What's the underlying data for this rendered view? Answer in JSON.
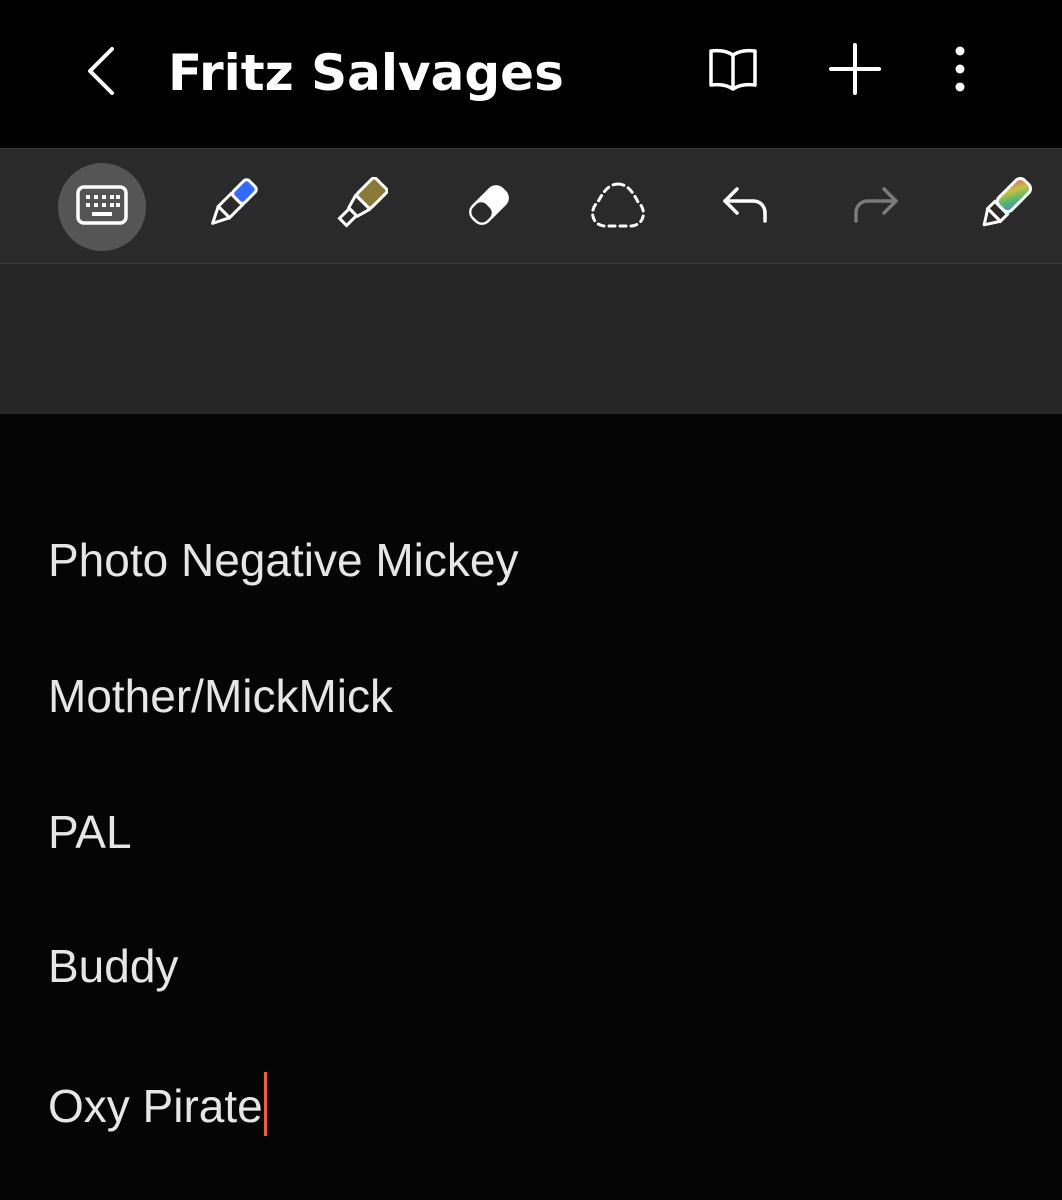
{
  "header": {
    "title": "Fritz Salvages",
    "back_icon": "chevron-left-icon",
    "actions": [
      "book-view-icon",
      "plus-icon",
      "more-vertical-icon"
    ]
  },
  "toolbar": {
    "tools": [
      {
        "name": "keyboard-icon",
        "active": true
      },
      {
        "name": "pen-icon",
        "color": "#2f6bff"
      },
      {
        "name": "highlighter-icon",
        "color": "#8a7a3a"
      },
      {
        "name": "eraser-icon"
      },
      {
        "name": "lasso-select-icon"
      },
      {
        "name": "undo-icon"
      },
      {
        "name": "redo-icon",
        "disabled": true
      },
      {
        "name": "pen-settings-icon"
      }
    ]
  },
  "note": {
    "lines": [
      "Photo Negative Mickey",
      "Mother/MickMick",
      "PAL",
      "Buddy",
      "Oxy Pirate"
    ],
    "cursor_color": "#ff5a36"
  }
}
